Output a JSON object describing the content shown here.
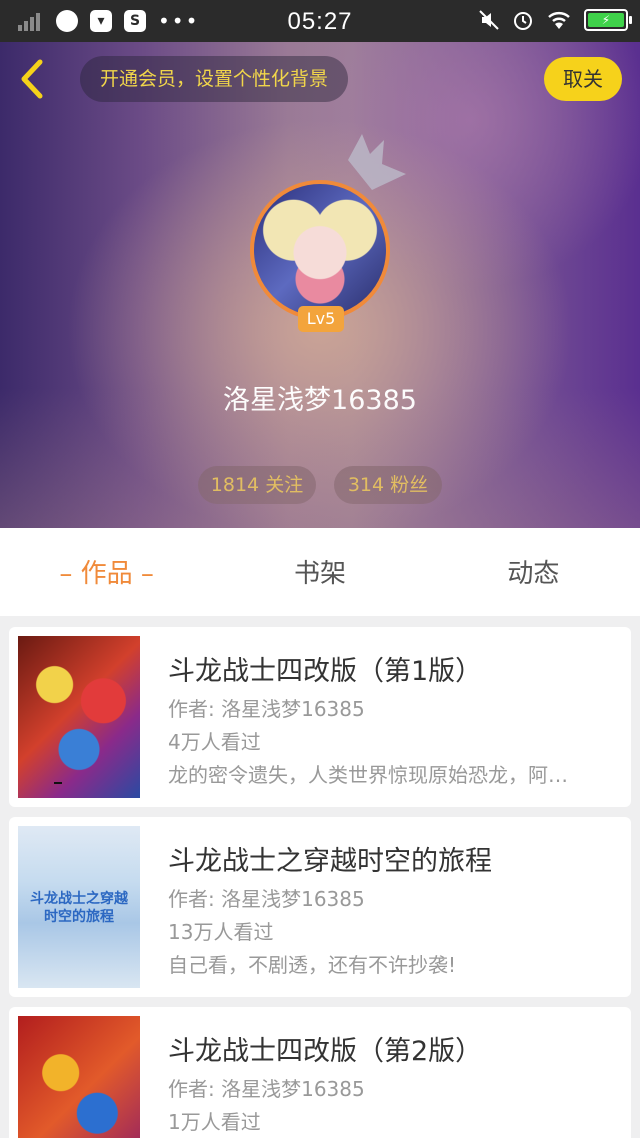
{
  "status_bar": {
    "time": "05:27",
    "icons": [
      "signal-icon",
      "browser-icon",
      "bag-icon",
      "app-s-icon",
      "more-dots-icon",
      "mute-icon",
      "alarm-icon",
      "wifi-icon",
      "battery-icon"
    ],
    "more": "•••",
    "s_label": "S"
  },
  "header": {
    "vip_hint": "开通会员，设置个性化背景",
    "unfollow_label": "取关"
  },
  "profile": {
    "level": "Lv5",
    "username": "洛星浅梦16385",
    "following": "1814 关注",
    "fans": "314 粉丝"
  },
  "tabs": [
    {
      "label": "– 作品 –",
      "active": true
    },
    {
      "label": "书架",
      "active": false
    },
    {
      "label": "动态",
      "active": false
    }
  ],
  "works": [
    {
      "title": "斗龙战士四改版（第1版）",
      "author": "作者: 洛星浅梦16385",
      "views": "4万人看过",
      "description": "龙的密令遗失，人类世界惊现原始恐龙，阿…"
    },
    {
      "title": "斗龙战士之穿越时空的旅程",
      "author": "作者: 洛星浅梦16385",
      "views": "13万人看过",
      "description": "自己看，不剧透，还有不许抄袭!",
      "cover_text": "斗龙战士之穿越时空的旅程"
    },
    {
      "title": "斗龙战士四改版（第2版）",
      "author": "作者: 洛星浅梦16385",
      "views": "1万人看过",
      "description": ""
    }
  ],
  "colors": {
    "accent_yellow": "#f6d21b",
    "accent_orange": "#f08a3a",
    "text_gray": "#999999"
  }
}
